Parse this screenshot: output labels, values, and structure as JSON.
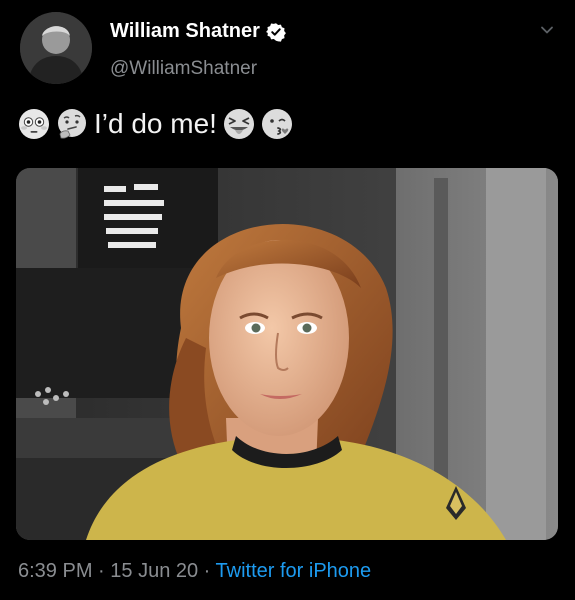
{
  "author": {
    "display_name": "William Shatner",
    "handle": "@WilliamShatner",
    "verified": true
  },
  "tweet": {
    "text": "I’d do me!",
    "leading_emojis": [
      "flushed-face-emoji",
      "thinking-face-emoji"
    ],
    "trailing_emojis": [
      "squinting-tongue-face-emoji",
      "kissing-wink-face-emoji"
    ]
  },
  "media": {
    "alt": ""
  },
  "footer": {
    "time": "6:39 PM",
    "separator": " · ",
    "date": "15 Jun 20",
    "source": "Twitter for iPhone"
  },
  "colors": {
    "background": "#000000",
    "secondary_text": "#8a8d91",
    "link": "#1d9bf0",
    "verified_badge": "#ffffff"
  }
}
